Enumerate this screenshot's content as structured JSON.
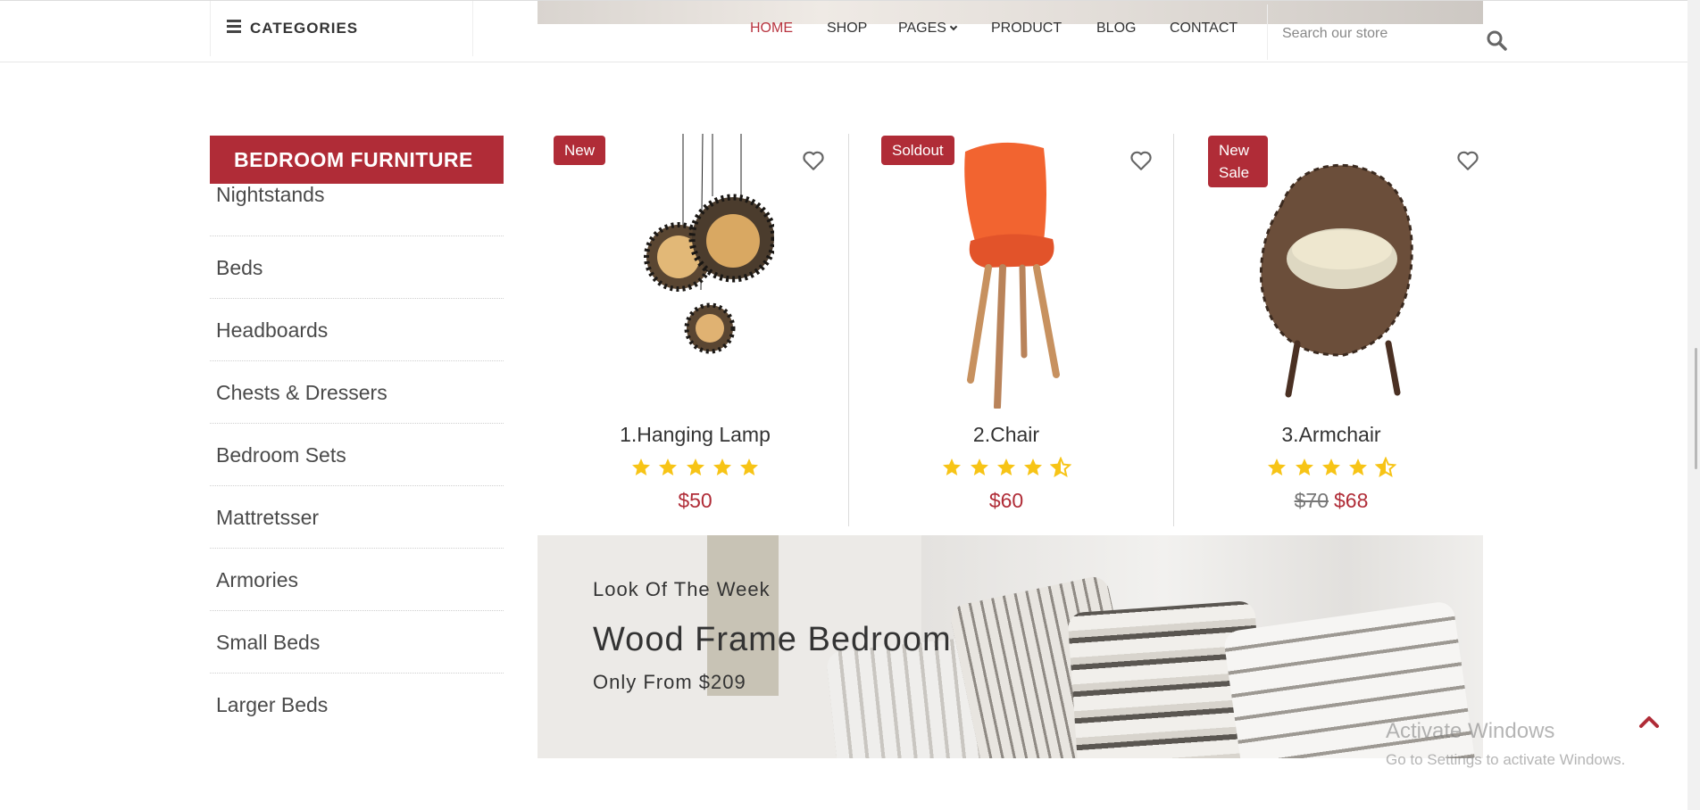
{
  "header": {
    "categories_label": "CATEGORIES",
    "nav": [
      {
        "label": "HOME",
        "active": true
      },
      {
        "label": "SHOP"
      },
      {
        "label": "PAGES",
        "has_dropdown": true
      },
      {
        "label": "PRODUCT"
      },
      {
        "label": "BLOG"
      },
      {
        "label": "CONTACT"
      }
    ],
    "search_placeholder": "Search our store"
  },
  "sidebar": {
    "title": "BEDROOM FURNITURE",
    "items": [
      "Nightstands",
      "Beds",
      "Headboards",
      "Chests & Dressers",
      "Bedroom Sets",
      "Mattretsser",
      "Armories",
      "Small Beds",
      "Larger Beds"
    ]
  },
  "products": [
    {
      "badge": "New",
      "name": "1.Hanging Lamp",
      "rating": 5,
      "price": "$50"
    },
    {
      "badge": "Soldout",
      "name": "2.Chair",
      "rating": 4.5,
      "price": "$60"
    },
    {
      "badge": "New Sale",
      "name": "3.Armchair",
      "rating": 4.5,
      "old_price": "$70",
      "price": "$68"
    }
  ],
  "banner": {
    "eyebrow": "Look Of The Week",
    "title": "Wood Frame Bedroom",
    "subtitle": "Only From $209"
  },
  "watermark": {
    "line1": "Activate Windows",
    "line2": "Go to Settings to activate Windows."
  },
  "colors": {
    "accent": "#b02c37",
    "star": "#f7c416",
    "text": "#333333"
  },
  "icons": {
    "categories": "menu-icon",
    "search": "search-icon",
    "wishlist": "heart-icon",
    "rating": "star-icon",
    "scroll_top": "chevron-up-icon"
  }
}
